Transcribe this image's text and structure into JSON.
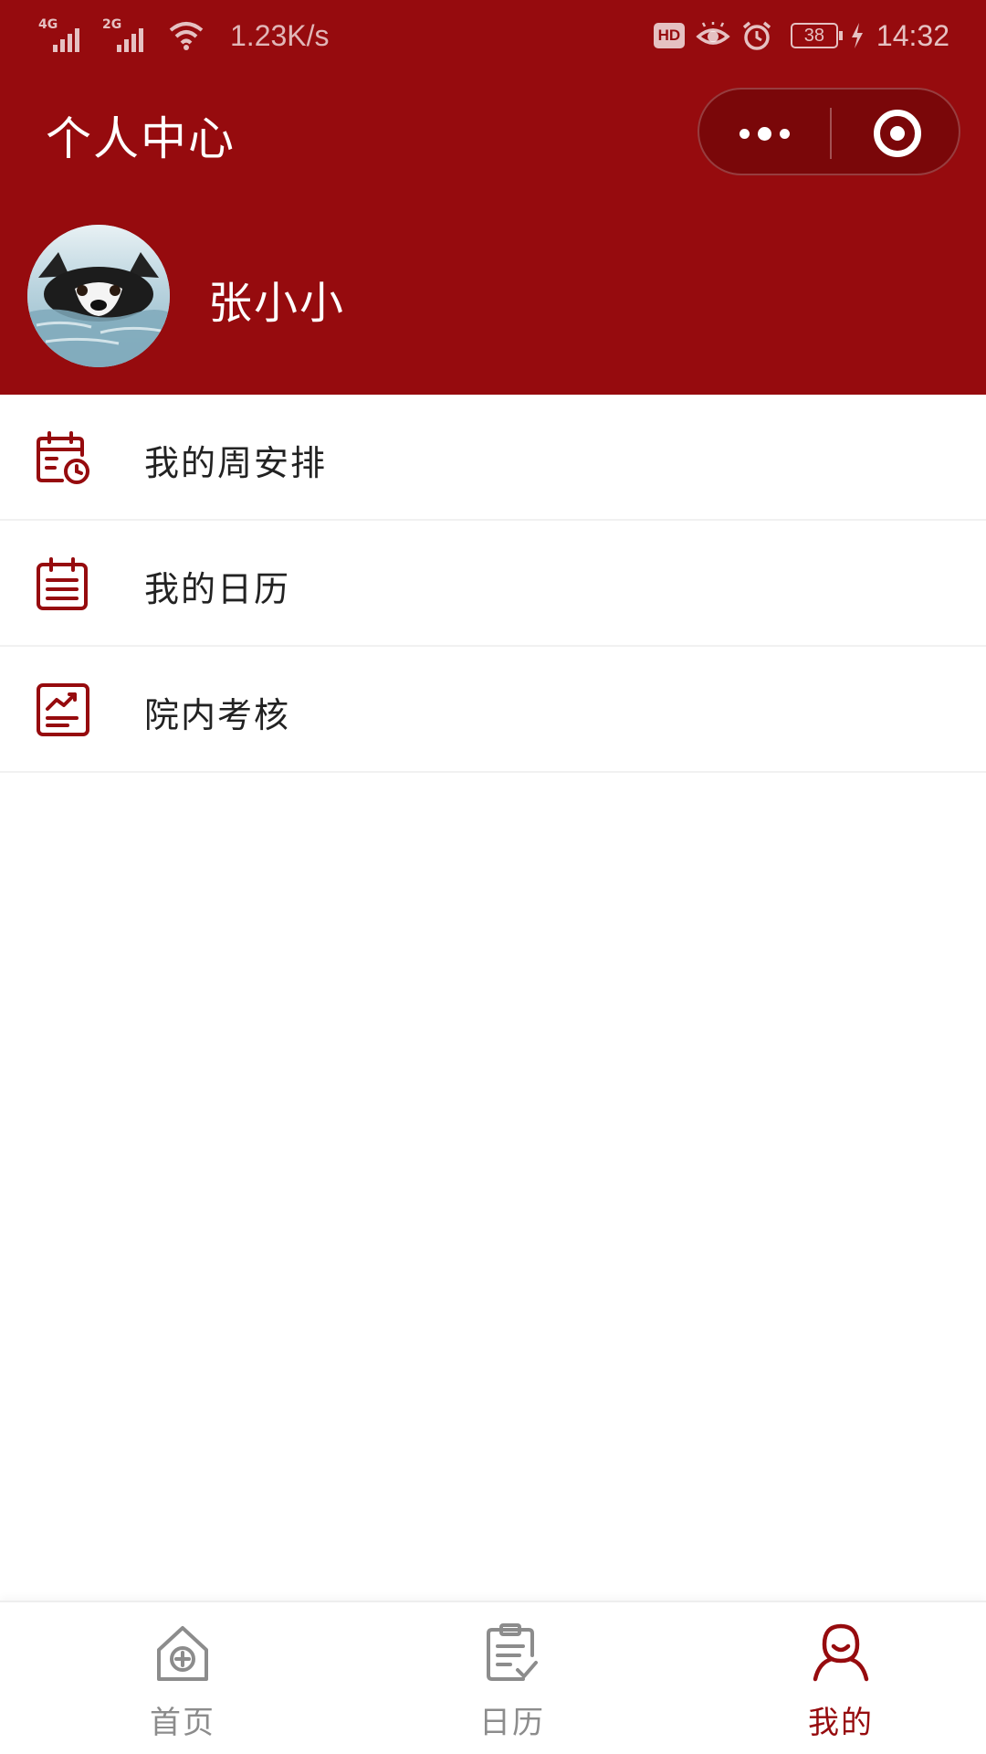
{
  "status_bar": {
    "network_1": "4G",
    "network_2": "2G",
    "speed": "1.23K/s",
    "hd": "HD",
    "battery": "38",
    "time": "14:32",
    "icons": [
      "signal-icon",
      "wifi-icon",
      "eye-icon",
      "alarm-icon",
      "battery-icon",
      "charging-icon"
    ]
  },
  "nav": {
    "title": "个人中心",
    "capsule_icons": [
      "more-icon",
      "close-target-icon"
    ]
  },
  "profile": {
    "name": "张小小",
    "avatar_icon": "avatar-husky-photo"
  },
  "menu": {
    "items": [
      {
        "label": "我的周安排",
        "icon": "calendar-clock-icon"
      },
      {
        "label": "我的日历",
        "icon": "calendar-list-icon"
      },
      {
        "label": "院内考核",
        "icon": "chart-report-icon"
      }
    ]
  },
  "tabbar": {
    "items": [
      {
        "label": "首页",
        "icon": "home-medical-icon",
        "active": false
      },
      {
        "label": "日历",
        "icon": "clipboard-check-icon",
        "active": false
      },
      {
        "label": "我的",
        "icon": "person-icon",
        "active": true
      }
    ]
  },
  "colors": {
    "brand": "#960b0e",
    "capsule": "#7a0709",
    "tab_inactive": "#8c8c8c",
    "text": "#222222"
  }
}
